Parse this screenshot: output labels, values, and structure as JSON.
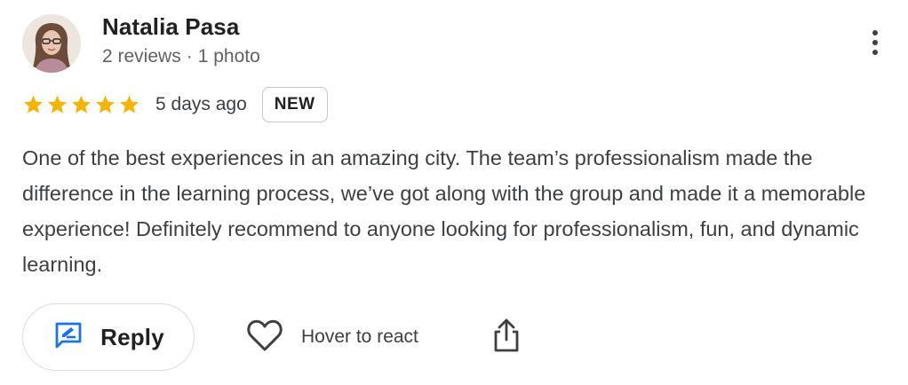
{
  "author": {
    "name": "Natalia Pasa",
    "reviews": "2 reviews",
    "separator": "·",
    "photos": "1 photo"
  },
  "rating": {
    "stars": 5,
    "max_stars": 5,
    "date": "5 days ago",
    "badge": "NEW"
  },
  "review": {
    "text": "One of the best experiences in an amazing city. The team’s professionalism made the difference in the learning process, we’ve got along with the group and made it a memorable experience! Definitely recommend to anyone looking for professionalism, fun, and dynamic learning."
  },
  "actions": {
    "reply_label": "Reply",
    "react_label": "Hover to react"
  },
  "icons": {
    "more": "more-vert-icon",
    "star": "star-icon",
    "reply": "reply-edit-icon",
    "heart": "heart-outline-icon",
    "share": "share-icon"
  },
  "colors": {
    "star": "#f4b400",
    "reply_icon": "#1a73e8",
    "text": "#3c4043",
    "muted": "#5f6368"
  }
}
